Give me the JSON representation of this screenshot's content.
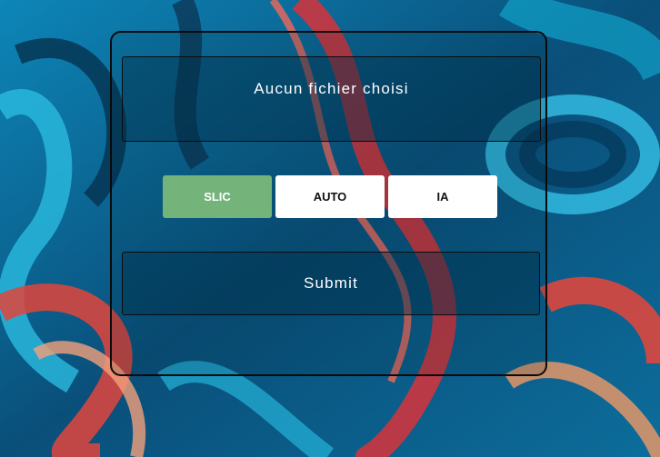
{
  "upload": {
    "status_text": "Aucun fichier choisi"
  },
  "modes": {
    "options": [
      "SLIC",
      "AUTO",
      "IA"
    ],
    "selected": "SLIC"
  },
  "actions": {
    "submit_label": "Submit"
  },
  "colors": {
    "active_mode": "#74b47a",
    "inactive_mode": "#ffffff",
    "panel_border": "#0a0a0a"
  }
}
